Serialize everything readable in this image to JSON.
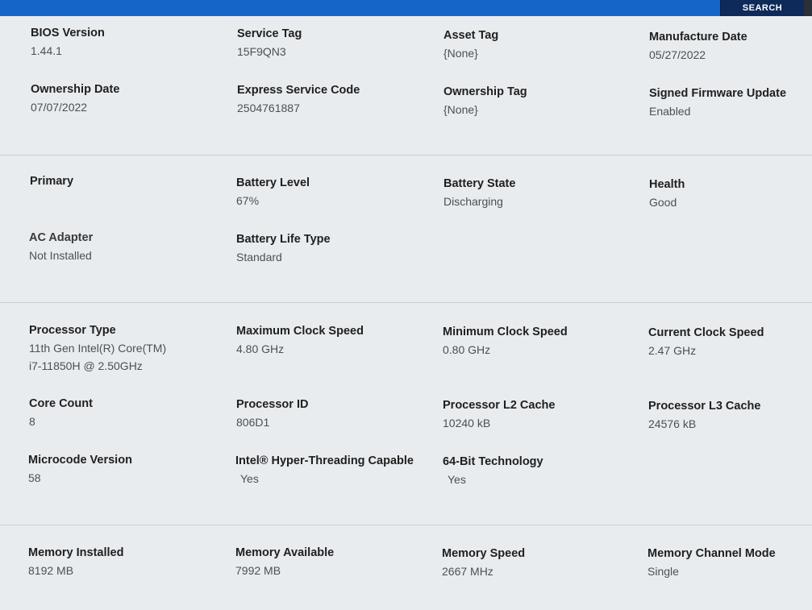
{
  "header": {
    "search_label": "SEARCH"
  },
  "system": [
    {
      "label": "BIOS Version",
      "value": "1.44.1"
    },
    {
      "label": "Service Tag",
      "value": "15F9QN3"
    },
    {
      "label": "Asset Tag",
      "value": "{None}"
    },
    {
      "label": "Manufacture Date",
      "value": "05/27/2022"
    },
    {
      "label": "Ownership Date",
      "value": "07/07/2022"
    },
    {
      "label": "Express Service Code",
      "value": "2504761887"
    },
    {
      "label": "Ownership Tag",
      "value": "{None}"
    },
    {
      "label": "Signed Firmware Update",
      "value": "Enabled"
    }
  ],
  "battery": [
    {
      "label": "Primary",
      "value": ""
    },
    {
      "label": "Battery Level",
      "value": "67%"
    },
    {
      "label": "Battery State",
      "value": "Discharging"
    },
    {
      "label": "Health",
      "value": "Good"
    },
    {
      "label": "AC Adapter",
      "value": "Not Installed"
    },
    {
      "label": "Battery Life Type",
      "value": "Standard"
    }
  ],
  "processor": [
    {
      "label": "Processor Type",
      "value": "11th Gen Intel(R) Core(TM)",
      "value2": "i7-11850H @ 2.50GHz"
    },
    {
      "label": "Maximum Clock Speed",
      "value": "4.80 GHz"
    },
    {
      "label": "Minimum Clock Speed",
      "value": "0.80 GHz"
    },
    {
      "label": "Current Clock Speed",
      "value": "2.47 GHz"
    },
    {
      "label": "Core Count",
      "value": "8"
    },
    {
      "label": "Processor ID",
      "value": "806D1"
    },
    {
      "label": "Processor L2 Cache",
      "value": "10240 kB"
    },
    {
      "label": "Processor L3 Cache",
      "value": "24576 kB"
    },
    {
      "label": "Microcode Version",
      "value": "58"
    },
    {
      "label": "Intel® Hyper-Threading Capable",
      "value": "Yes"
    },
    {
      "label": "64-Bit Technology",
      "value": "Yes"
    }
  ],
  "memory": [
    {
      "label": "Memory Installed",
      "value": "8192 MB"
    },
    {
      "label": "Memory Available",
      "value": "7992 MB"
    },
    {
      "label": "Memory Speed",
      "value": "2667 MHz"
    },
    {
      "label": "Memory Channel Mode",
      "value": "Single"
    }
  ]
}
